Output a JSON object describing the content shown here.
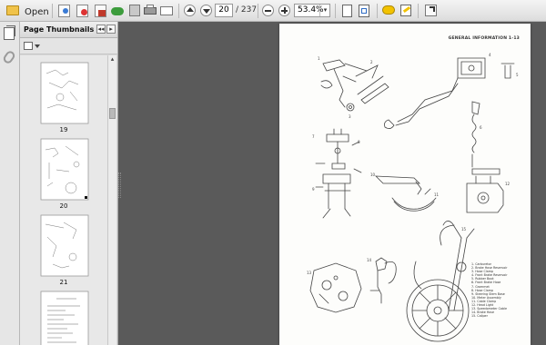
{
  "toolbar": {
    "open_label": "Open",
    "current_page": "20",
    "page_total": "/ 237",
    "zoom": "53.4%",
    "zoom_dropdown_glyph": "▾"
  },
  "icons": [
    "folder-open-icon",
    "download-icon",
    "upload-icon",
    "cloud-icon",
    "save-icon",
    "print-icon",
    "email-icon",
    "previous-page-icon",
    "next-page-icon",
    "zoom-out-icon",
    "zoom-in-icon",
    "fit-page-icon",
    "full-screen-icon",
    "comment-icon",
    "sign-icon",
    "expand-icon",
    "pages-icon",
    "attachment-icon",
    "options-icon"
  ],
  "thumbnail_panel": {
    "title": "Page Thumbnails",
    "collapse_glyph": "◂◂",
    "expand_glyph": "▸",
    "scroll_up_glyph": "▴",
    "thumbnails": [
      {
        "label": "19"
      },
      {
        "label": "20"
      },
      {
        "label": "21"
      },
      {
        "label": ""
      }
    ]
  },
  "document": {
    "page_header": "GENERAL INFORMATION 1-13",
    "legend": [
      "1. Carburetor",
      "2. Brake Hose Reservoir",
      "3. Hose Clamp",
      "4. Front Brake Reservoir",
      "5. Rubber Boot",
      "6. Front Brake Hose",
      "7. Grommet",
      "8. Hose Clamp",
      "9. Steering Stem Base",
      "10. Meter Assembly",
      "11. Cable Clamp",
      "12. Head Light",
      "13. Speedometer Cable",
      "14. Brake Hose",
      "15. Caliper"
    ]
  },
  "colors": {
    "toolbar_bg": "#e6e6e6",
    "workspace_bg": "#5a5a5a",
    "page_bg": "#fdfdfb",
    "accent_green": "#3c9c3c",
    "accent_blue": "#2d6bc4",
    "accent_yellow": "#f2c200"
  }
}
